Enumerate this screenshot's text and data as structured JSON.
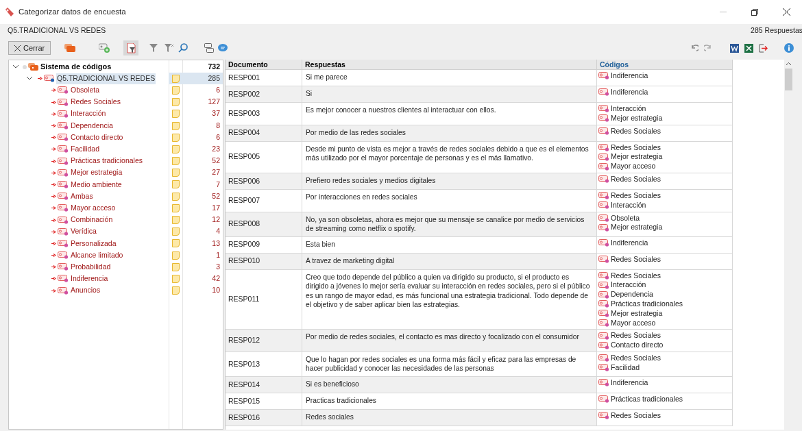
{
  "window": {
    "title": "Categorizar datos de encuesta"
  },
  "header": {
    "question": "Q5.TRADICIONAL VS REDES",
    "count": "285 Respuestas"
  },
  "toolbar": {
    "close_label": "Cerrar"
  },
  "tree": {
    "label": "Sistema de códigos",
    "count": "732",
    "expanded": true,
    "selected": false,
    "children": [
      {
        "label": "Q5.TRADICIONAL VS REDES",
        "count": "285",
        "expanded": true,
        "selected": true,
        "children": [
          {
            "label": "Obsoleta",
            "count": "6",
            "selected": false
          },
          {
            "label": "Redes Sociales",
            "count": "127",
            "selected": false
          },
          {
            "label": "Interacción",
            "count": "37",
            "selected": false
          },
          {
            "label": "Dependencia",
            "count": "8",
            "selected": false
          },
          {
            "label": "Contacto directo",
            "count": "6",
            "selected": false
          },
          {
            "label": "Facilidad",
            "count": "23",
            "selected": false
          },
          {
            "label": "Prácticas tradicionales",
            "count": "52",
            "selected": false
          },
          {
            "label": "Mejor estrategia",
            "count": "27",
            "selected": false
          },
          {
            "label": "Medio ambiente",
            "count": "7",
            "selected": false
          },
          {
            "label": "Ambas",
            "count": "52",
            "selected": false
          },
          {
            "label": "Mayor acceso",
            "count": "17",
            "selected": false
          },
          {
            "label": "Combinación",
            "count": "12",
            "selected": false
          },
          {
            "label": "Verídica",
            "count": "4",
            "selected": false
          },
          {
            "label": "Personalizada",
            "count": "13",
            "selected": false
          },
          {
            "label": "Alcance limitado",
            "count": "1",
            "selected": false
          },
          {
            "label": "Probabilidad",
            "count": "3",
            "selected": false
          },
          {
            "label": "Indiferencia",
            "count": "42",
            "selected": false
          },
          {
            "label": "Anuncios",
            "count": "10",
            "selected": false
          }
        ]
      }
    ]
  },
  "table": {
    "columns": [
      "Documento",
      "Respuestas",
      "Códigos"
    ],
    "rows": [
      {
        "document": "RESP001",
        "response": "Si me parece",
        "codes": [
          "Indiferencia"
        ]
      },
      {
        "document": "RESP002",
        "response": "Si",
        "codes": [
          "Indiferencia"
        ]
      },
      {
        "document": "RESP003",
        "response": "Es mejor conocer a nuestros clientes al interactuar con ellos.",
        "codes": [
          "Interacción",
          "Mejor estrategia"
        ]
      },
      {
        "document": "RESP004",
        "response": "Por medio de las redes sociales",
        "codes": [
          "Redes Sociales"
        ]
      },
      {
        "document": "RESP005",
        "response": "Desde mi punto de vista es mejor a través de redes sociales debido a que es el elementos más utilizado por el mayor porcentaje de personas y es el más llamativo.",
        "codes": [
          "Redes Sociales",
          "Mejor estrategia",
          "Mayor acceso"
        ]
      },
      {
        "document": "RESP006",
        "response": "Prefiero redes sociales y medios digitales",
        "codes": [
          "Redes Sociales"
        ]
      },
      {
        "document": "RESP007",
        "response": "Por interacciones en redes sociales",
        "codes": [
          "Redes Sociales",
          "Interacción"
        ]
      },
      {
        "document": "RESP008",
        "response": "No, ya son obsoletas, ahora es mejor que su mensaje se canalice por medio de servicios de streaming como netflix o spotify.",
        "codes": [
          "Obsoleta",
          "Mejor estrategia"
        ]
      },
      {
        "document": "RESP009",
        "response": "Esta bien",
        "codes": [
          "Indiferencia"
        ]
      },
      {
        "document": "RESP010",
        "response": "A travez de marketing digital",
        "codes": [
          "Redes Sociales"
        ]
      },
      {
        "document": "RESP011",
        "response": "Creo que todo depende del público a quien va dirigido su producto, si el producto es dirigido a jóvenes lo mejor sería evaluar su interacción en redes sociales, pero si el público es un rango de mayor edad, es más funcional una estrategia tradicional. Todo depende de el objetivo y de saber aplicar bien las estrategias.",
        "codes": [
          "Redes Sociales",
          "Interacción",
          "Dependencia",
          "Prácticas tradicionales",
          "Mejor estrategia",
          "Mayor acceso"
        ]
      },
      {
        "document": "RESP012",
        "response": "Por medio de redes sociales, el contacto es mas directo y focalizado con el consumidor",
        "codes": [
          "Redes Sociales",
          "Contacto directo"
        ]
      },
      {
        "document": "RESP013",
        "response": "Que lo hagan por redes sociales es una forma más  fácil y eficaz para las empresas de hacer publicidad y conocer las necesidades de las personas",
        "codes": [
          "Redes Sociales",
          "Facilidad"
        ]
      },
      {
        "document": "RESP014",
        "response": "Si es beneficioso",
        "codes": [
          "Indiferencia"
        ]
      },
      {
        "document": "RESP015",
        "response": "Practicas tradicionales",
        "codes": [
          "Prácticas tradicionales"
        ]
      },
      {
        "document": "RESP016",
        "response": "Redes sociales",
        "codes": [
          "Redes Sociales"
        ]
      }
    ]
  }
}
